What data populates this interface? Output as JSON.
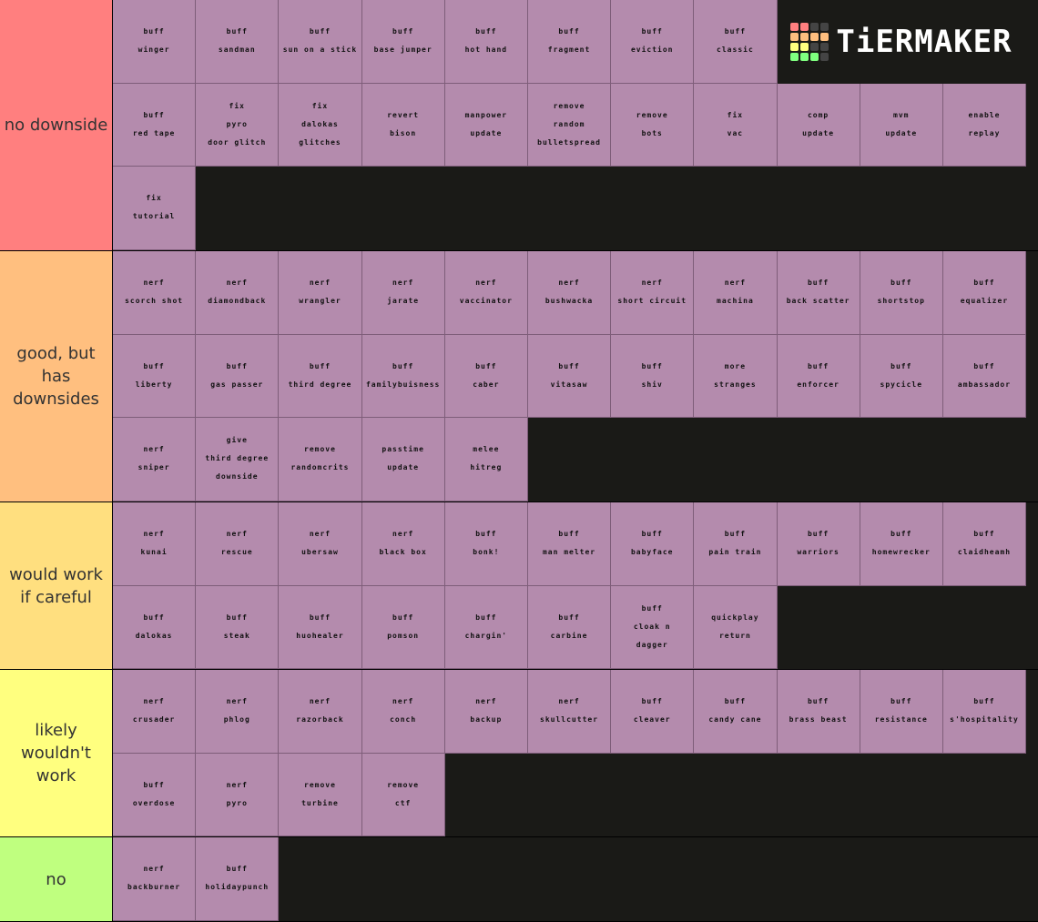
{
  "logo": {
    "text": "TiERMAKER",
    "grid_colors": [
      "#ff7f7f",
      "#ff7f7f",
      "#444",
      "#444",
      "#ffbf7f",
      "#ffbf7f",
      "#ffbf7f",
      "#ffbf7f",
      "#ffff7f",
      "#ffff7f",
      "#444",
      "#444",
      "#7fff7f",
      "#7fff7f",
      "#7fff7f",
      "#444"
    ]
  },
  "tiers": [
    {
      "label": "no downside",
      "color": "#ff7f7f",
      "items": [
        [
          "buff",
          "winger"
        ],
        [
          "buff",
          "sandman"
        ],
        [
          "buff",
          "sun on a stick"
        ],
        [
          "buff",
          "base jumper"
        ],
        [
          "buff",
          "hot hand"
        ],
        [
          "buff",
          "fragment"
        ],
        [
          "buff",
          "eviction"
        ],
        [
          "buff",
          "classic"
        ],
        [
          "buff",
          "red tape"
        ],
        [
          "fix",
          "pyro",
          "door glitch"
        ],
        [
          "fix",
          "dalokas",
          "glitches"
        ],
        [
          "revert",
          "bison"
        ],
        [
          "manpower",
          "update"
        ],
        [
          "remove",
          "random",
          "bulletspread"
        ],
        [
          "remove",
          "bots"
        ],
        [
          "fix",
          "vac"
        ],
        [
          "comp",
          "update"
        ],
        [
          "mvm",
          "update"
        ],
        [
          "enable",
          "replay"
        ],
        [
          "fix",
          "tutorial"
        ]
      ]
    },
    {
      "label": "good, but has downsides",
      "color": "#ffbf7f",
      "items": [
        [
          "nerf",
          "scorch shot"
        ],
        [
          "nerf",
          "diamondback"
        ],
        [
          "nerf",
          "wrangler"
        ],
        [
          "nerf",
          "jarate"
        ],
        [
          "nerf",
          "vaccinator"
        ],
        [
          "nerf",
          "bushwacka"
        ],
        [
          "nerf",
          "short circuit"
        ],
        [
          "nerf",
          "machina"
        ],
        [
          "buff",
          "back scatter"
        ],
        [
          "buff",
          "shortstop"
        ],
        [
          "buff",
          "equalizer"
        ],
        [
          "buff",
          "liberty"
        ],
        [
          "buff",
          "gas passer"
        ],
        [
          "buff",
          "third degree"
        ],
        [
          "buff",
          "familybuisness"
        ],
        [
          "buff",
          "caber"
        ],
        [
          "buff",
          "vitasaw"
        ],
        [
          "buff",
          "shiv"
        ],
        [
          "more",
          "stranges"
        ],
        [
          "buff",
          "enforcer"
        ],
        [
          "buff",
          "spycicle"
        ],
        [
          "buff",
          "ambassador"
        ],
        [
          "nerf",
          "sniper"
        ],
        [
          "give",
          "third degree",
          "downside"
        ],
        [
          "remove",
          "randomcrits"
        ],
        [
          "passtime",
          "update"
        ],
        [
          "melee",
          "hitreg"
        ]
      ]
    },
    {
      "label": "would work if careful",
      "color": "#ffdf7f",
      "items": [
        [
          "nerf",
          "kunai"
        ],
        [
          "nerf",
          "rescue"
        ],
        [
          "nerf",
          "ubersaw"
        ],
        [
          "nerf",
          "black box"
        ],
        [
          "buff",
          "bonk!"
        ],
        [
          "buff",
          "man melter"
        ],
        [
          "buff",
          "babyface"
        ],
        [
          "buff",
          "pain train"
        ],
        [
          "buff",
          "warriors"
        ],
        [
          "buff",
          "homewrecker"
        ],
        [
          "buff",
          "claidheamh"
        ],
        [
          "buff",
          "dalokas"
        ],
        [
          "buff",
          "steak"
        ],
        [
          "buff",
          "huohealer"
        ],
        [
          "buff",
          "pomson"
        ],
        [
          "buff",
          "chargin'"
        ],
        [
          "buff",
          "carbine"
        ],
        [
          "buff",
          "cloak n",
          "dagger"
        ],
        [
          "quickplay",
          "return"
        ]
      ]
    },
    {
      "label": "likely wouldn't work",
      "color": "#ffff7f",
      "items": [
        [
          "nerf",
          "crusader"
        ],
        [
          "nerf",
          "phlog"
        ],
        [
          "nerf",
          "razorback"
        ],
        [
          "nerf",
          "conch"
        ],
        [
          "nerf",
          "backup"
        ],
        [
          "nerf",
          "skullcutter"
        ],
        [
          "buff",
          "cleaver"
        ],
        [
          "buff",
          "candy cane"
        ],
        [
          "buff",
          "brass beast"
        ],
        [
          "buff",
          "resistance"
        ],
        [
          "buff",
          "s'hospitality"
        ],
        [
          "buff",
          "overdose"
        ],
        [
          "nerf",
          "pyro"
        ],
        [
          "remove",
          "turbine"
        ],
        [
          "remove",
          "ctf"
        ]
      ]
    },
    {
      "label": "no",
      "color": "#bfff7f",
      "items": [
        [
          "nerf",
          "backburner"
        ],
        [
          "buff",
          "holidaypunch"
        ]
      ]
    }
  ]
}
